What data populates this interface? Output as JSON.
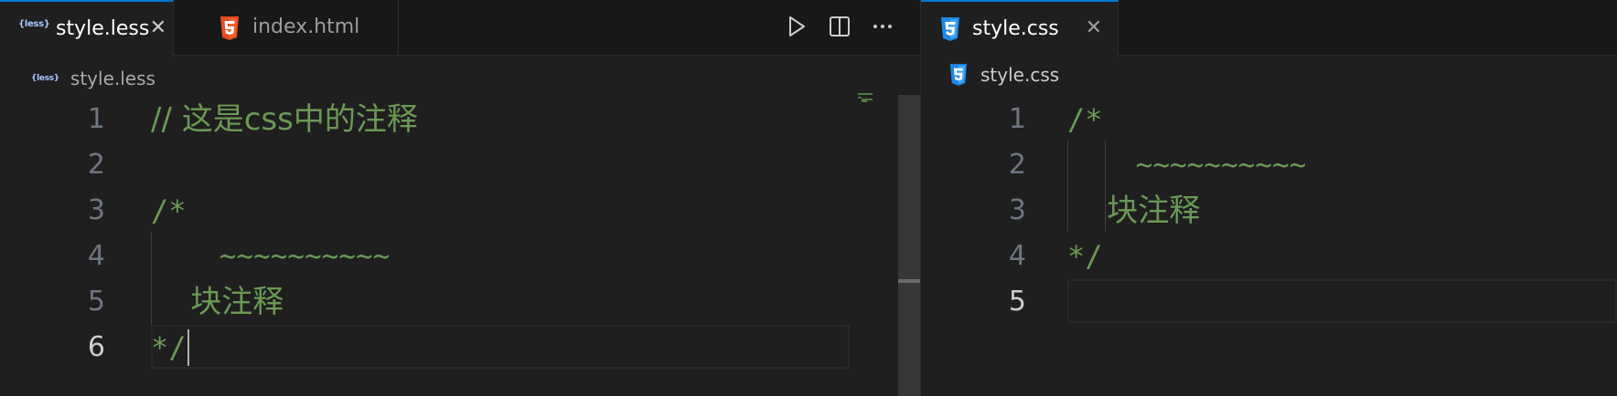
{
  "left_editor": {
    "tabs": [
      {
        "label": "style.less",
        "icon": "less-icon",
        "icon_text": "{less}",
        "active": true,
        "close": "✕"
      },
      {
        "label": "index.html",
        "icon": "html5-icon",
        "active": false
      }
    ],
    "actions": [
      "run-icon",
      "split-editor-icon",
      "more-actions-icon"
    ],
    "breadcrumb": {
      "icon": "less-icon",
      "icon_text": "{less}",
      "label": "style.less"
    },
    "lines": [
      {
        "number": "1",
        "text": "// 这是css中的注释"
      },
      {
        "number": "2",
        "text": ""
      },
      {
        "number": "3",
        "text": "/*"
      },
      {
        "number": "4",
        "text": "    ~~~~~~~~~~"
      },
      {
        "number": "5",
        "text": "    块注释"
      },
      {
        "number": "6",
        "text": "*/"
      }
    ],
    "current_line": "6"
  },
  "right_editor": {
    "tabs": [
      {
        "label": "style.css",
        "icon": "css3-icon",
        "active": true,
        "close": "✕"
      }
    ],
    "breadcrumb": {
      "icon": "css3-icon",
      "label": "style.css"
    },
    "lines": [
      {
        "number": "1",
        "text": "/*"
      },
      {
        "number": "2",
        "text": "    ~~~~~~~~~~"
      },
      {
        "number": "3",
        "text": "    块注释"
      },
      {
        "number": "4",
        "text": "*/"
      },
      {
        "number": "5",
        "text": ""
      }
    ],
    "current_line": "5"
  },
  "colors": {
    "background": "#1f1f1f",
    "tabbar": "#181818",
    "comment": "#6a9955",
    "line_number": "#6e7681",
    "active_line_number": "#cccccc",
    "html_icon": "#e44d26",
    "css_icon": "#1e88e5"
  }
}
